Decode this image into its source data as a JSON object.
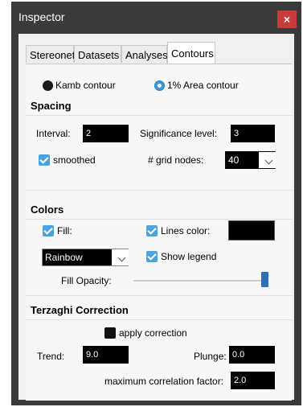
{
  "window": {
    "title": "Inspector",
    "close_symbol": "×"
  },
  "tabs": [
    {
      "label": "Stereonet",
      "active": false
    },
    {
      "label": "Datasets",
      "active": false
    },
    {
      "label": "Analyses",
      "active": false
    },
    {
      "label": "Contours",
      "active": true
    }
  ],
  "contour_mode": {
    "kamb_label": "Kamb contour",
    "area_label": "1% Area contour",
    "selected": "1% Area contour"
  },
  "spacing": {
    "title": "Spacing",
    "interval_label": "Interval:",
    "interval_value": "2",
    "significance_label": "Significance level:",
    "significance_value": "3",
    "smoothed_label": "smoothed",
    "smoothed_checked": true,
    "grid_nodes_label": "# grid nodes:",
    "grid_nodes_value": "40"
  },
  "colors": {
    "title": "Colors",
    "fill_label": "Fill:",
    "fill_checked": true,
    "lines_color_label": "Lines color:",
    "lines_color_checked": true,
    "lines_color_value": "#000000",
    "colormap_value": "Rainbow",
    "show_legend_label": "Show legend",
    "show_legend_checked": true,
    "fill_opacity_label": "Fill Opacity:",
    "fill_opacity_value": 1.0
  },
  "terzaghi": {
    "title": "Terzaghi Correction",
    "apply_label": "apply correction",
    "apply_checked": false,
    "trend_label": "Trend:",
    "trend_value": "9.0",
    "plunge_label": "Plunge:",
    "plunge_value": "0.0",
    "max_corr_label": "maximum correlation factor:",
    "max_corr_value": "2.0"
  },
  "colors_palette": {
    "accent": "#4aa3df",
    "title_bar": "#3a3a3a",
    "close": "#c73b3b",
    "slider": "#2d6fb7"
  }
}
